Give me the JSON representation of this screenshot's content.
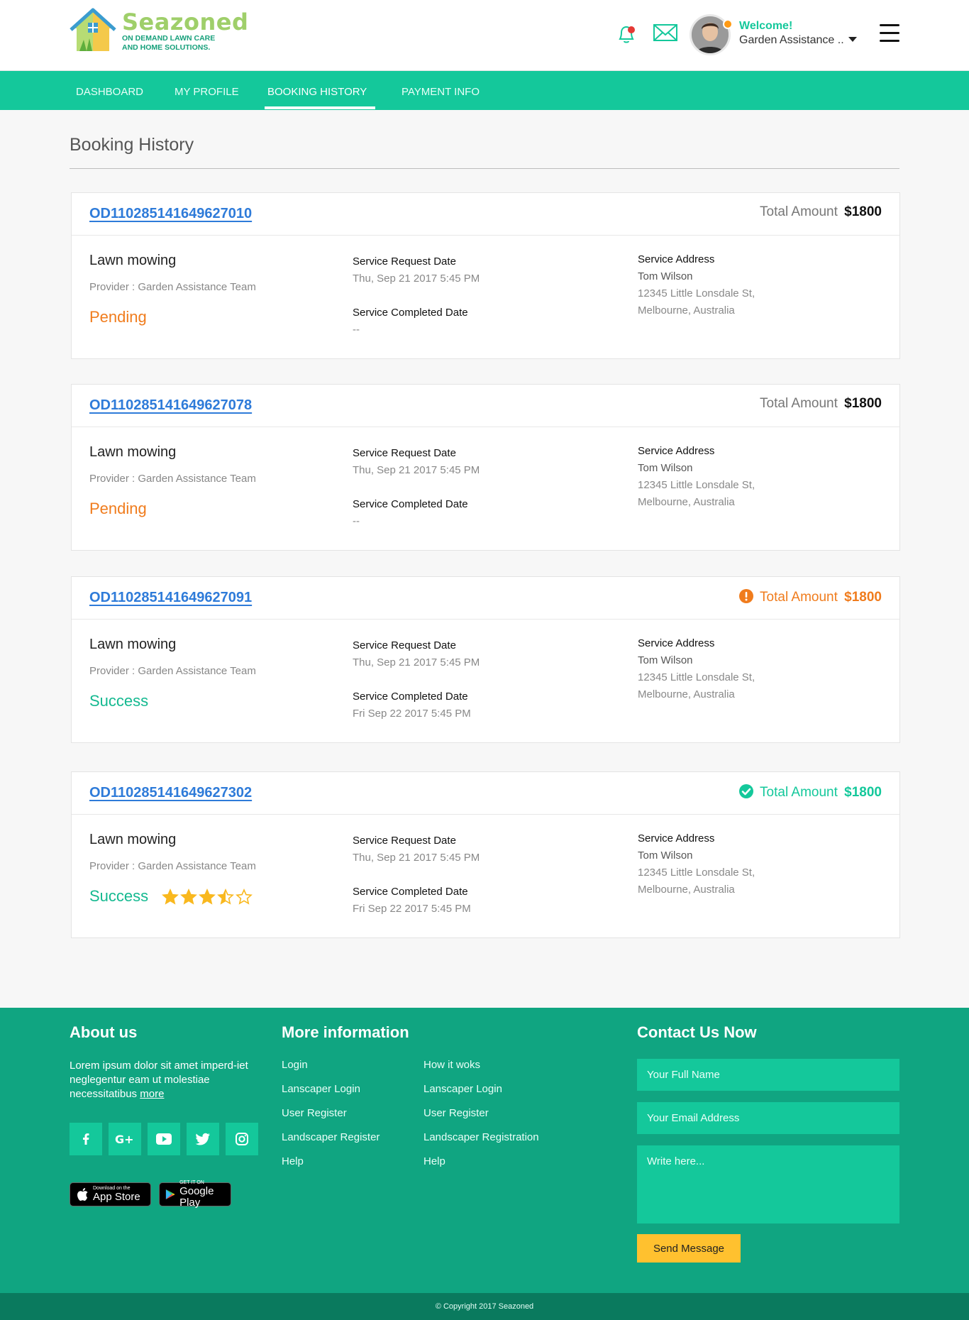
{
  "brand": {
    "name": "Seazoned",
    "tagline_line1": "ON DEMAND LAWN CARE",
    "tagline_line2": "AND HOME SOLUTIONS."
  },
  "header": {
    "welcome": "Welcome!",
    "user_name": "Garden Assistance ..",
    "icons": [
      "bell-icon",
      "mail-icon",
      "menu-icon"
    ]
  },
  "nav": {
    "items": [
      {
        "label": "DASHBOARD"
      },
      {
        "label": "MY PROFILE"
      },
      {
        "label": "BOOKING HISTORY",
        "active": true
      },
      {
        "label": "PAYMENT INFO"
      }
    ]
  },
  "page": {
    "title": "Booking History"
  },
  "labels": {
    "total_amount": "Total Amount",
    "service_request_date": "Service Request Date",
    "service_completed_date": "Service Completed Date",
    "service_address": "Service Address"
  },
  "bookings": [
    {
      "order_id": "OD110285141649627010",
      "total": "$1800",
      "total_status": "normal",
      "service": "Lawn mowing",
      "provider": "Provider : Garden Assistance Team",
      "status": "Pending",
      "request_date": "Thu, Sep 21 2017 5:45 PM",
      "completed_date": "--",
      "address_name": "Tom Wilson",
      "address_line1": "12345 Little Lonsdale St,",
      "address_line2": "Melbourne, Australia"
    },
    {
      "order_id": "OD110285141649627078",
      "total": "$1800",
      "total_status": "normal",
      "service": "Lawn mowing",
      "provider": "Provider : Garden Assistance Team",
      "status": "Pending",
      "request_date": "Thu, Sep 21 2017 5:45 PM",
      "completed_date": "--",
      "address_name": "Tom Wilson",
      "address_line1": "12345 Little Lonsdale St,",
      "address_line2": "Melbourne, Australia"
    },
    {
      "order_id": "OD110285141649627091",
      "total": "$1800",
      "total_status": "warning",
      "service": "Lawn mowing",
      "provider": "Provider : Garden Assistance Team",
      "status": "Success",
      "request_date": "Thu, Sep 21 2017 5:45 PM",
      "completed_date": "Fri Sep 22 2017 5:45 PM",
      "address_name": "Tom Wilson",
      "address_line1": "12345 Little Lonsdale St,",
      "address_line2": "Melbourne, Australia"
    },
    {
      "order_id": "OD110285141649627302",
      "total": "$1800",
      "total_status": "paid",
      "service": "Lawn mowing",
      "provider": "Provider : Garden Assistance Team",
      "status": "Success",
      "rating": 3.5,
      "rating_max": 5,
      "request_date": "Thu, Sep 21 2017 5:45 PM",
      "completed_date": "Fri Sep 22 2017 5:45 PM",
      "address_name": "Tom Wilson",
      "address_line1": "12345 Little Lonsdale St,",
      "address_line2": "Melbourne, Australia"
    }
  ],
  "footer": {
    "about_title": "About us",
    "about_text": "Lorem ipsum dolor sit amet imperd-iet neglegentur eam ut molestiae necessitatibus",
    "about_more": "more",
    "social": [
      "facebook-icon",
      "google-plus-icon",
      "youtube-icon",
      "twitter-icon",
      "instagram-icon"
    ],
    "app_store_small": "Download on the",
    "app_store_big": "App Store",
    "google_play_small": "GET IT ON",
    "google_play_big": "Google Play",
    "more_title": "More information",
    "links_col1": [
      "Login",
      "Lanscaper Login",
      "User Register",
      "Landscaper Register",
      "Help"
    ],
    "links_col2": [
      "How it woks",
      "Lanscaper Login",
      "User Register",
      "Landscaper Registration",
      "Help"
    ],
    "contact_title": "Contact Us Now",
    "name_placeholder": "Your Full Name",
    "email_placeholder": "Your Email Address",
    "message_placeholder": "Write here...",
    "send_label": "Send Message",
    "copyright": "© Copyright 2017 Seazoned"
  },
  "colors": {
    "accent": "#14c89b",
    "footer": "#10a581",
    "pending": "#f07c1d",
    "link": "#2e7bd9",
    "button": "#ffc12f"
  }
}
